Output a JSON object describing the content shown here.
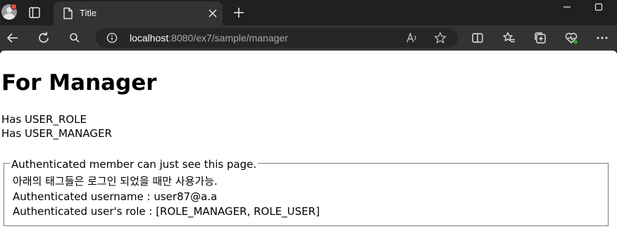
{
  "browser": {
    "tab": {
      "title": "Title"
    },
    "address": {
      "host": "localhost",
      "path": ":8080/ex7/sample/manager"
    }
  },
  "page": {
    "heading": "For Manager",
    "roles": [
      "Has USER_ROLE",
      "Has USER_MANAGER"
    ],
    "fieldset": {
      "legend": "Authenticated member can just see this page.",
      "lines": [
        "아래의 태그들은 로그인 되었을 때만 사용가능.",
        "Authenticated username : user87@a.a",
        "Authenticated user's role : [ROLE_MANAGER, ROLE_USER]"
      ]
    }
  }
}
